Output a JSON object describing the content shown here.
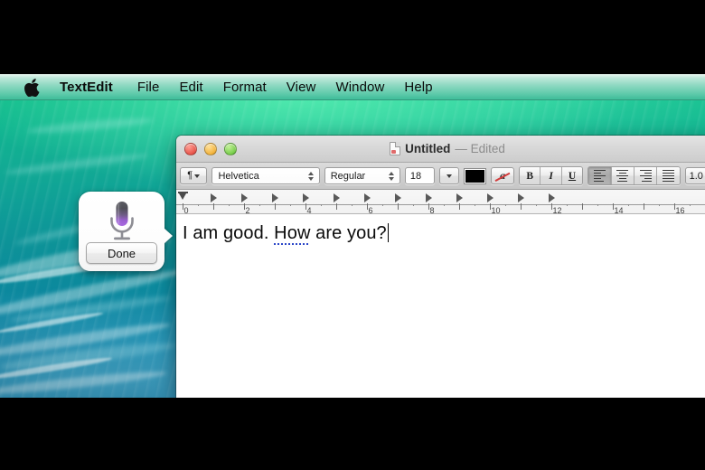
{
  "menubar": {
    "apple_icon": "apple-logo-icon",
    "app_name": "TextEdit",
    "items": [
      "File",
      "Edit",
      "Format",
      "View",
      "Window",
      "Help"
    ]
  },
  "window": {
    "traffic_lights": {
      "close": "close-button",
      "minimize": "minimize-button",
      "zoom": "zoom-button"
    },
    "title": "Untitled",
    "title_status": "— Edited",
    "document_icon": "document-icon"
  },
  "toolbar": {
    "paragraph_style_icon": "pilcrow-icon",
    "font_family": "Helvetica",
    "font_style": "Regular",
    "font_size": "18",
    "text_color": "#000000",
    "highlight_icon": "highlight-none-icon",
    "highlight_slash_color": "#d23b3b",
    "bold_label": "B",
    "italic_label": "I",
    "underline_label": "U",
    "align_left": "align-left",
    "align_center": "align-center",
    "align_right": "align-right",
    "align_justify": "align-justify",
    "active_alignment": "align-left",
    "line_spacing": "1.0"
  },
  "ruler": {
    "labels": [
      "0",
      "2",
      "4",
      "6",
      "8",
      "10",
      "12",
      "14",
      "16"
    ],
    "tab_stop_count": 12,
    "unit": "inches"
  },
  "document": {
    "text_before": "I am good. ",
    "text_dictated": "How",
    "text_after": " are you?",
    "full_text": "I am good. How are you?",
    "caret_visible": true
  },
  "dictation": {
    "mic_icon": "microphone-icon",
    "done_label": "Done",
    "mic_gradient_top": "#4a4a50",
    "mic_gradient_bottom": "#9d5fd6"
  }
}
